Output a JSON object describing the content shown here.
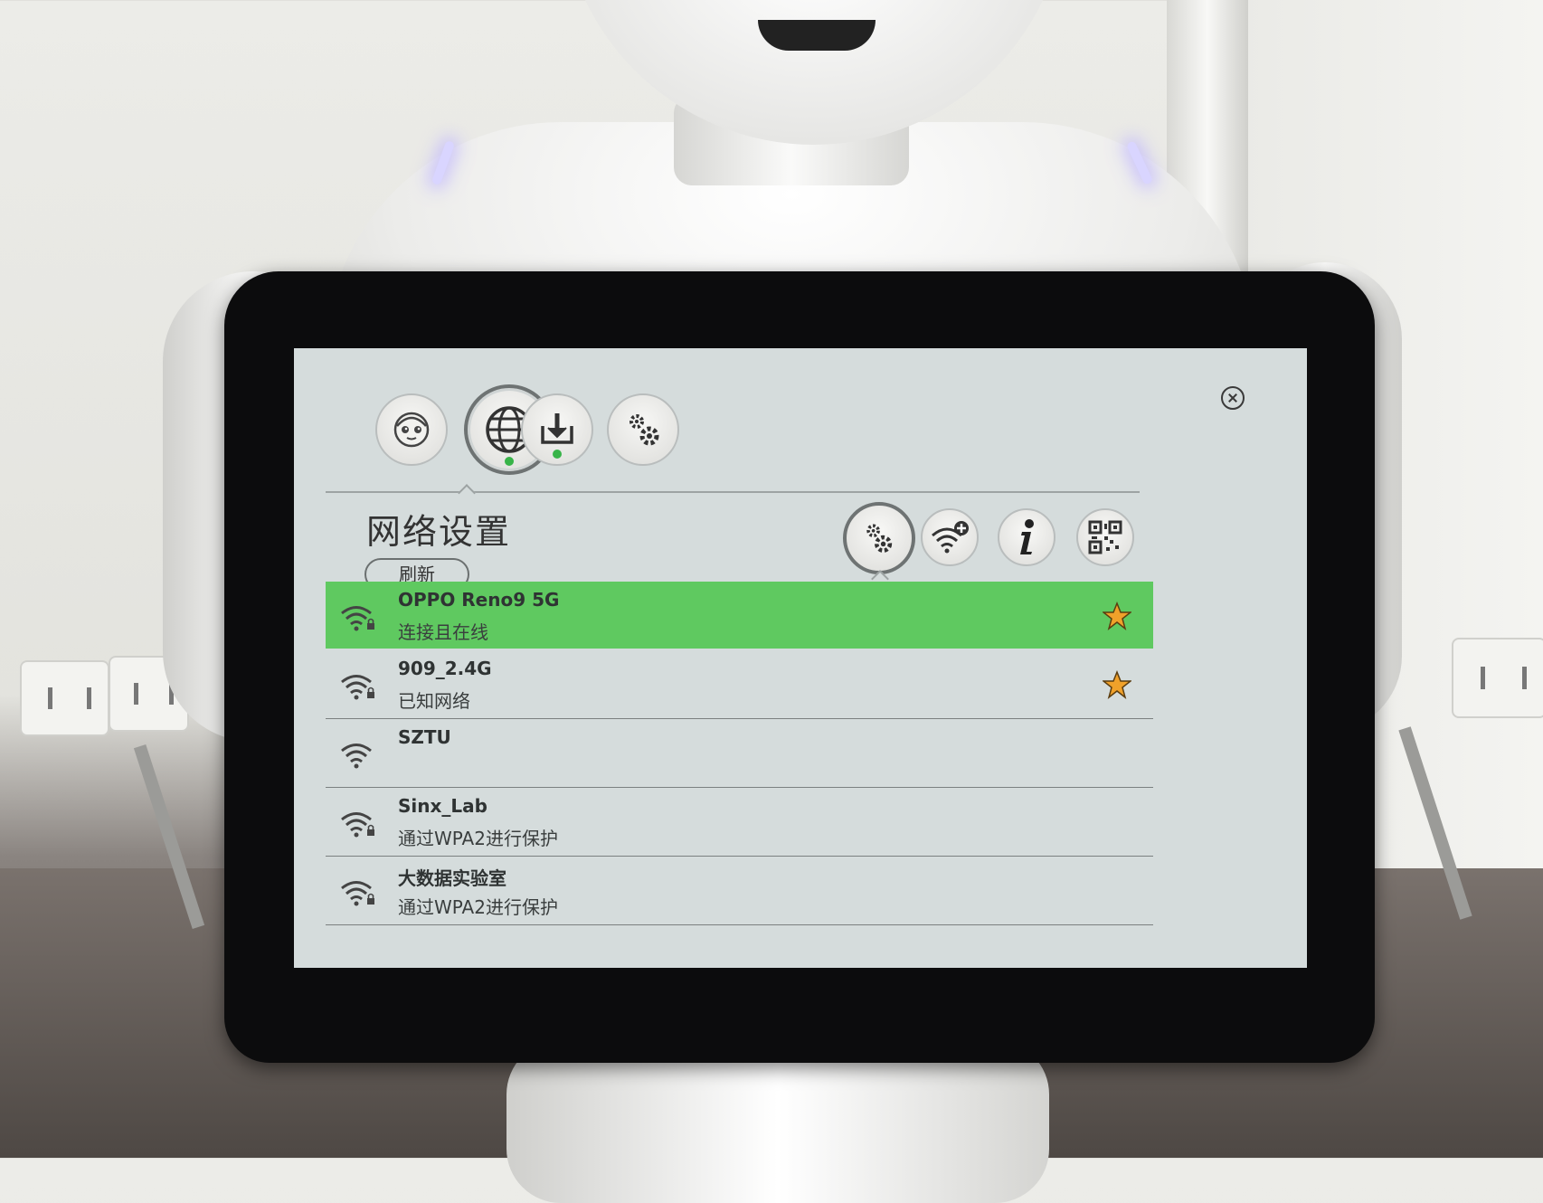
{
  "nav": {
    "tabs": [
      {
        "icon": "robot-face-icon",
        "active": false,
        "status_dot": false
      },
      {
        "icon": "globe-icon",
        "active": true,
        "status_dot": true
      },
      {
        "icon": "download-icon",
        "active": false,
        "status_dot": true
      },
      {
        "icon": "gear-icon",
        "active": false,
        "status_dot": false
      }
    ],
    "close_icon": "close-icon",
    "status_dot_color": "#38b449"
  },
  "page": {
    "title": "网络设置",
    "refresh_label": "刷新"
  },
  "tools": [
    {
      "icon": "settings-gear-icon",
      "active": true
    },
    {
      "icon": "add-wifi-icon",
      "active": false
    },
    {
      "icon": "info-icon",
      "active": false
    },
    {
      "icon": "qr-code-icon",
      "active": false
    }
  ],
  "networks": [
    {
      "name": "OPPO Reno9 5G",
      "status": "连接且在线",
      "secured": true,
      "favorite": true,
      "connected": true
    },
    {
      "name": "909_2.4G",
      "status": "已知网络",
      "secured": true,
      "favorite": true,
      "connected": false
    },
    {
      "name": "SZTU",
      "status": "",
      "secured": false,
      "favorite": false,
      "connected": false
    },
    {
      "name": "Sinx_Lab",
      "status": "通过WPA2进行保护",
      "secured": true,
      "favorite": false,
      "connected": false
    },
    {
      "name": "大数据实验室",
      "status": "通过WPA2进行保护",
      "secured": true,
      "favorite": false,
      "connected": false
    }
  ],
  "colors": {
    "connected_row": "#5fc960",
    "screen_bg": "#d5dcdc",
    "star": "#f0a12a"
  }
}
